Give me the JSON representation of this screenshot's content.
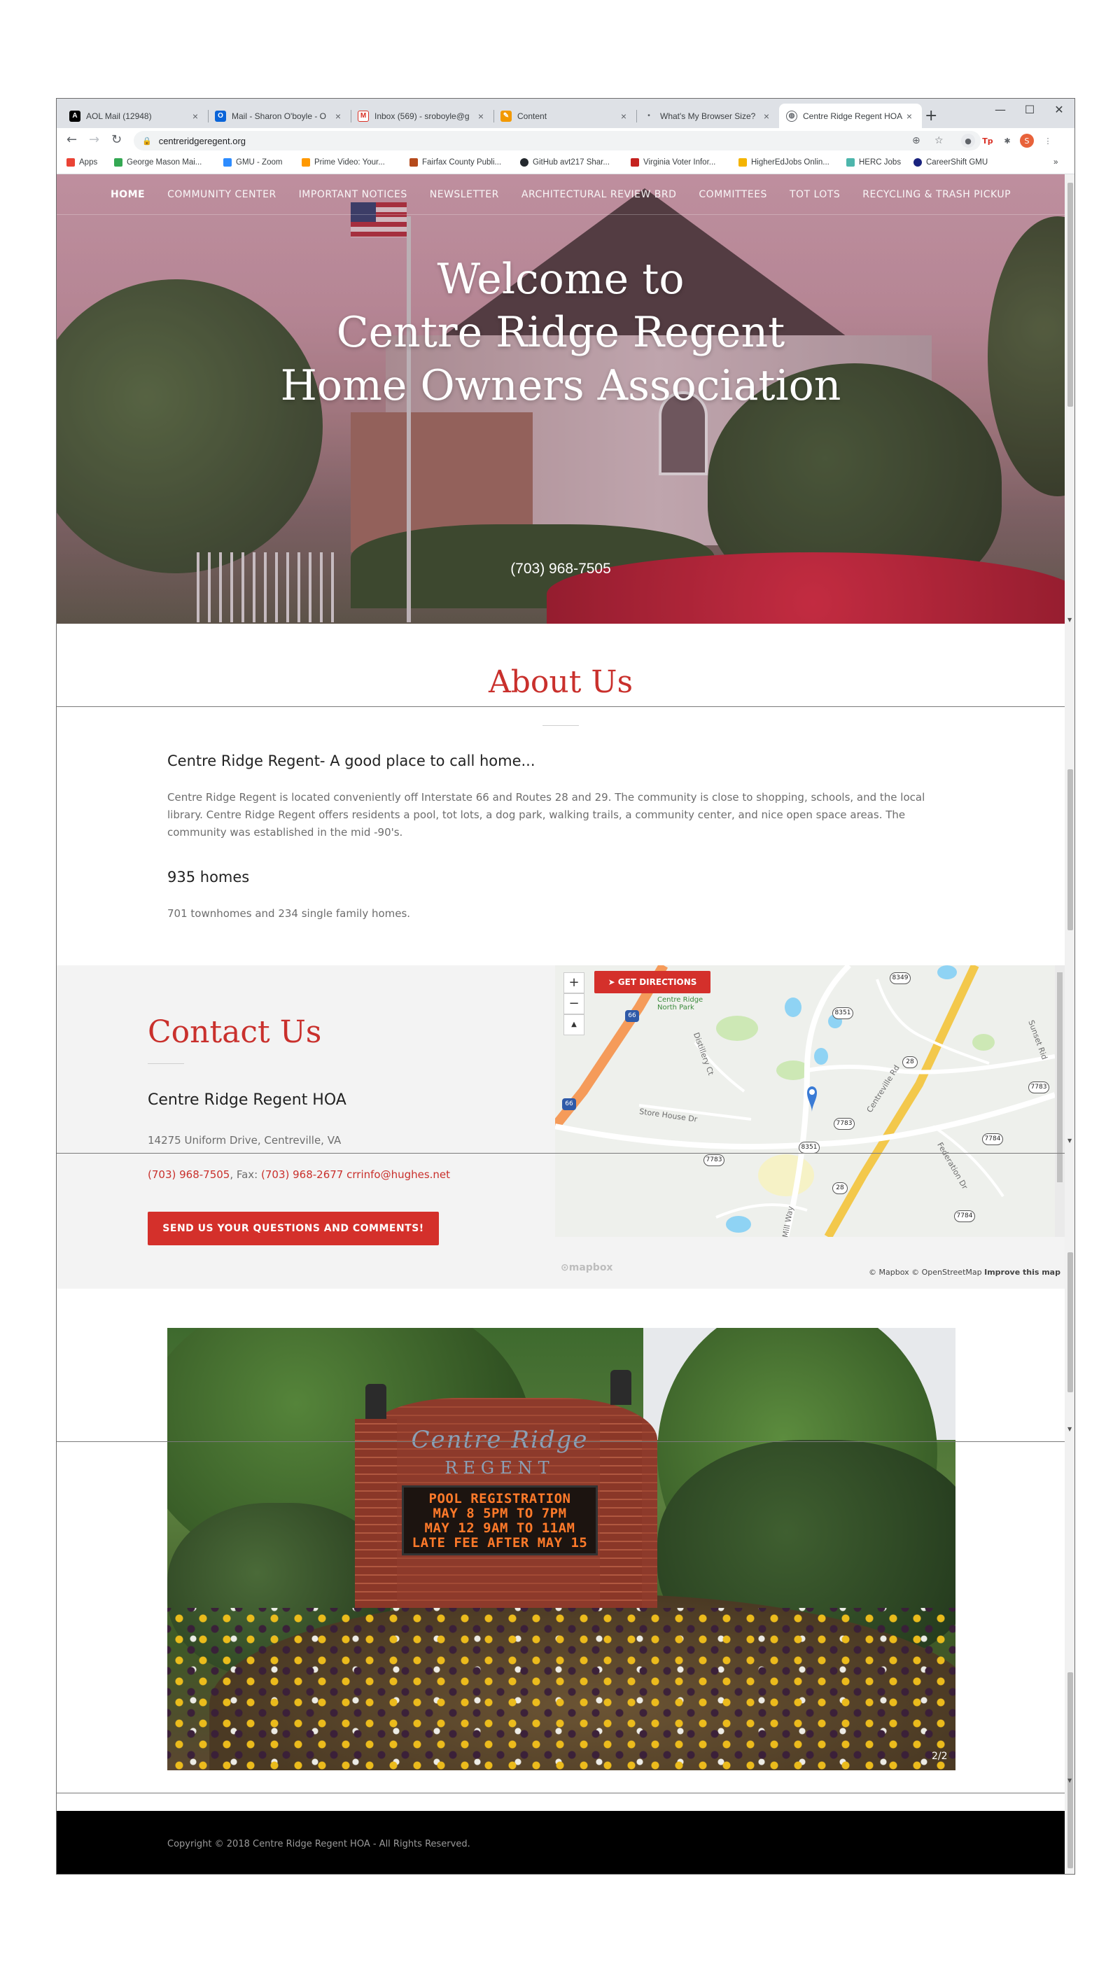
{
  "browser": {
    "tabs": [
      {
        "title": "AOL Mail (12948)",
        "icon": "aol-icon",
        "color": "#000000"
      },
      {
        "title": "Mail - Sharon O'boyle - O",
        "icon": "outlook-icon",
        "color": "#0a64d8"
      },
      {
        "title": "Inbox (569) - sroboyle@g",
        "icon": "gmail-icon",
        "color": "#d93025"
      },
      {
        "title": "Content",
        "icon": "content-icon",
        "color": "#f29900"
      },
      {
        "title": "What's My Browser Size?",
        "icon": "dot-icon",
        "color": "#5f6368"
      },
      {
        "title": "Centre Ridge Regent HOA",
        "icon": "globe-icon",
        "color": "#5f6368"
      }
    ],
    "active_tab": 5,
    "url": "centreridgeregent.org",
    "bookmarks": [
      {
        "label": "Apps",
        "color": "#ea4335"
      },
      {
        "label": "George Mason Mai...",
        "color": "#34a853"
      },
      {
        "label": "GMU - Zoom",
        "color": "#2d8cff"
      },
      {
        "label": "Prime Video: Your...",
        "color": "#ff9900"
      },
      {
        "label": "Fairfax County Publi...",
        "color": "#b54a1c"
      },
      {
        "label": "GitHub avt217 Shar...",
        "color": "#24292e"
      },
      {
        "label": "Virginia Voter Infor...",
        "color": "#c5221f"
      },
      {
        "label": "HigherEdJobs Onlin...",
        "color": "#f4b400"
      },
      {
        "label": "HERC Jobs",
        "color": "#4db6ac"
      },
      {
        "label": "CareerShift GMU",
        "color": "#1a237e"
      }
    ],
    "bookmarks_more": "»",
    "profile_initial": "S"
  },
  "nav": {
    "items": [
      "HOME",
      "COMMUNITY CENTER",
      "IMPORTANT NOTICES",
      "NEWSLETTER",
      "ARCHITECTURAL REVIEW BRD",
      "COMMITTEES",
      "TOT LOTS",
      "RECYCLING & TRASH PICKUP"
    ],
    "active": "HOME"
  },
  "hero": {
    "title_lines": [
      "Welcome to",
      "Centre Ridge Regent",
      "Home Owners Association"
    ],
    "phone": "(703) 968-7505"
  },
  "about": {
    "title": "About Us",
    "subtitle": "Centre Ridge Regent- A good place to call home...",
    "description": "Centre Ridge Regent is located conveniently off Interstate 66 and Routes 28 and 29. The community is close to shopping, schools, and the local library. Centre Ridge Regent offers residents a pool, tot lots, a dog park, walking trails, a community center, and nice open space areas. The community was established in the mid -90's.",
    "homes_heading": "935 homes",
    "homes_detail": "701 townhomes and 234 single family homes."
  },
  "contact": {
    "title": "Contact Us",
    "org": "Centre Ridge Regent HOA",
    "address": "14275 Uniform Drive, Centreville, VA",
    "phone": "(703) 968-7505",
    "fax_label": ", Fax: ",
    "fax": "(703) 968-2677",
    "email": "crrinfo@hughes.net",
    "button": "SEND US YOUR QUESTIONS AND COMMENTS!"
  },
  "map": {
    "directions": "GET DIRECTIONS",
    "zoom_in": "+",
    "zoom_out": "−",
    "compass": "▲",
    "labels": {
      "park": "Centre Ridge North Park",
      "road1": "Store House Dr",
      "road2": "Centreville Rd",
      "road3": "Sunset Rid",
      "road4": "Federation Dr",
      "road5": "Distillery Ct",
      "road6": "Mill Way"
    },
    "shields": [
      "8349",
      "8351",
      "28",
      "7783",
      "7783",
      "8351",
      "28",
      "7784",
      "7784",
      "7783"
    ],
    "interstate": "66",
    "attribution": "© Mapbox © OpenStreetMap",
    "improve": "Improve this map",
    "logo": "mapbox"
  },
  "photo": {
    "sign_name": "Centre Ridge",
    "sign_sub": "REGENT",
    "led_lines": [
      "POOL REGISTRATION",
      "MAY 8 5PM TO 7PM",
      "MAY 12 9AM TO 11AM",
      "LATE FEE AFTER MAY 15"
    ],
    "counter": "2/2"
  },
  "footer": {
    "copyright": "Copyright © 2018 Centre Ridge Regent HOA - All Rights Reserved."
  },
  "colors": {
    "accent": "#c9302c",
    "button": "#d4302b",
    "footer_bg": "#000000"
  }
}
